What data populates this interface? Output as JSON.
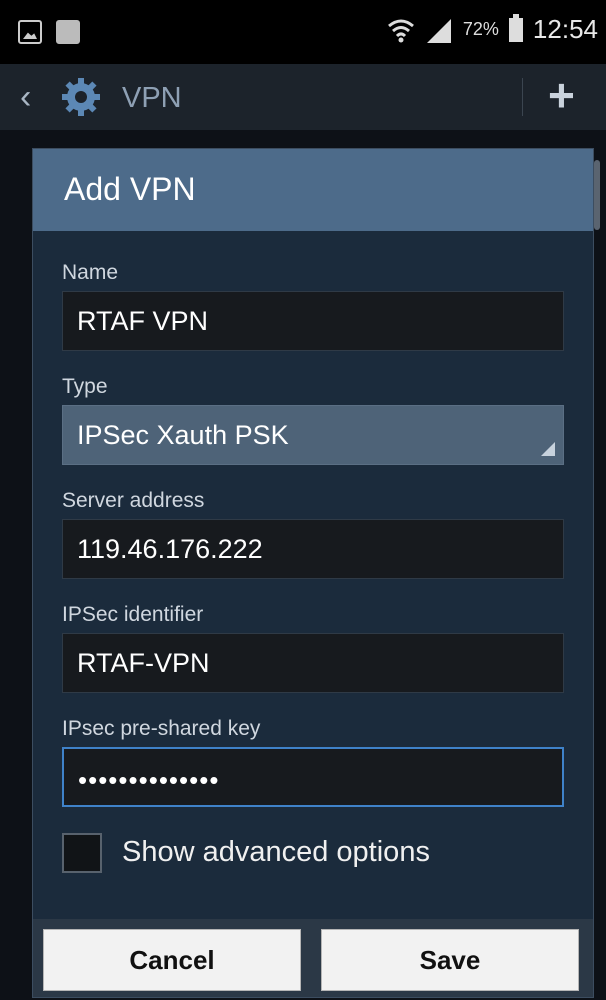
{
  "status_bar": {
    "battery_percent": "72%",
    "time": "12:54",
    "icons": [
      "gallery-icon",
      "message-icon",
      "wifi-icon",
      "signal-icon",
      "battery-icon"
    ]
  },
  "action_bar": {
    "title": "VPN",
    "back_icon": "chevron-left-icon",
    "settings_icon": "gear-icon",
    "add_icon": "plus-icon"
  },
  "dialog": {
    "title": "Add VPN",
    "fields": {
      "name": {
        "label": "Name",
        "value": "RTAF VPN"
      },
      "type": {
        "label": "Type",
        "value": "IPSec Xauth PSK"
      },
      "server": {
        "label": "Server address",
        "value": "119.46.176.222"
      },
      "identifier": {
        "label": "IPSec identifier",
        "value": "RTAF-VPN"
      },
      "psk": {
        "label": "IPsec pre-shared key",
        "value": "••••••••••••••"
      }
    },
    "advanced": {
      "label": "Show advanced options",
      "checked": false
    },
    "buttons": {
      "cancel": "Cancel",
      "save": "Save"
    }
  },
  "colors": {
    "header": "#4d6b8a",
    "dialog_bg": "#1b2b3c",
    "focus": "#3f82c9"
  }
}
